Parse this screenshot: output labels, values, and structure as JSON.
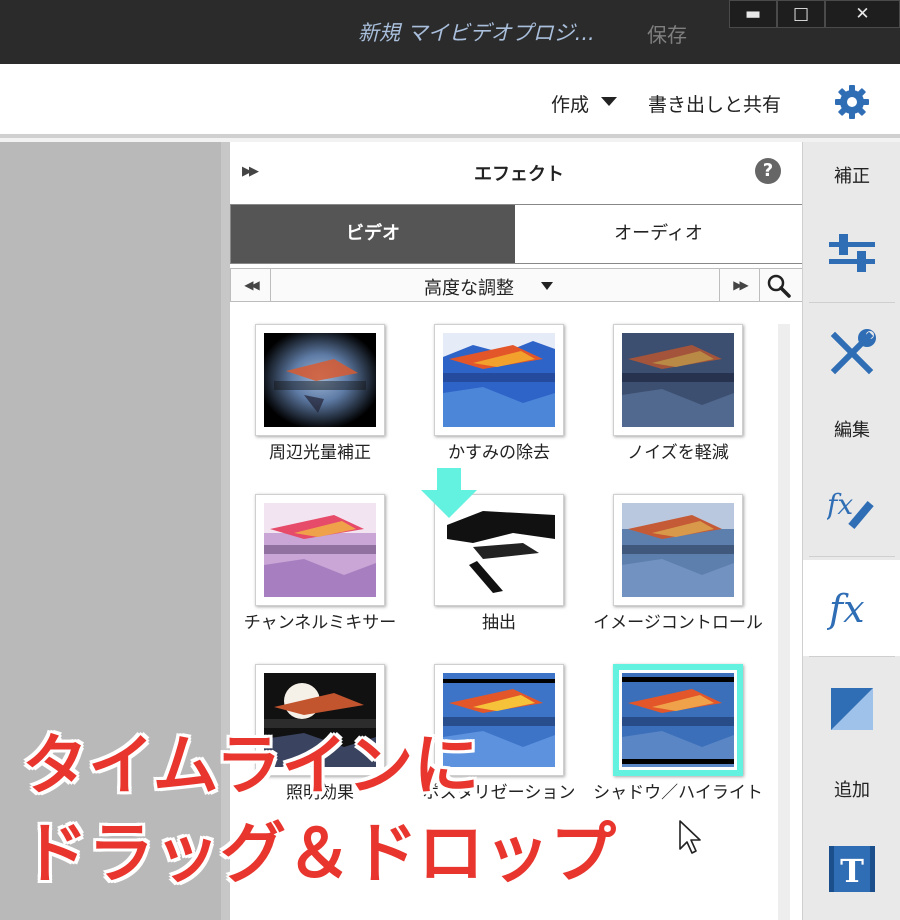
{
  "titlebar": {
    "project_title": "新規 マイビデオプロジ...",
    "save_label": "保存",
    "minimize_glyph": "▬",
    "maximize_glyph": "□",
    "close_glyph": "✕"
  },
  "menubar": {
    "create_label": "作成",
    "share_label": "書き出しと共有",
    "settings_icon": "gear-icon"
  },
  "effects_panel": {
    "expand_glyph": "▶▶",
    "title": "エフェクト",
    "help_glyph": "?",
    "tabs": [
      {
        "label": "ビデオ",
        "active": true
      },
      {
        "label": "オーディオ",
        "active": false
      }
    ],
    "category": {
      "prev_glyph": "◀◀",
      "label": "高度な調整",
      "next_glyph": "▶▶",
      "search_icon": "search-icon"
    },
    "effects": [
      {
        "label": "周辺光量補正",
        "thumbnail": "vignette"
      },
      {
        "label": "かすみの除去",
        "thumbnail": "haze-removal"
      },
      {
        "label": "ノイズを軽減",
        "thumbnail": "noise-reduction"
      },
      {
        "label": "チャンネルミキサー",
        "thumbnail": "channel-mixer"
      },
      {
        "label": "抽出",
        "thumbnail": "extract"
      },
      {
        "label": "イメージコントロール",
        "thumbnail": "image-control"
      },
      {
        "label": "照明効果",
        "thumbnail": "lighting"
      },
      {
        "label": "ポスタリゼーション",
        "thumbnail": "posterize"
      },
      {
        "label": "シャドウ／ハイライト",
        "thumbnail": "shadow-highlight",
        "highlighted": true
      }
    ]
  },
  "sidebar": {
    "section_adjust": "補正",
    "section_edit": "編集",
    "section_add": "追加",
    "buttons": [
      {
        "name": "adjust-sliders",
        "icon": "sliders-icon"
      },
      {
        "name": "tools",
        "icon": "wrench-screwdriver-icon"
      },
      {
        "name": "fx-edit",
        "icon": "fx-pencil-icon"
      },
      {
        "name": "fx",
        "icon": "fx-icon",
        "label": "fx",
        "active": true
      },
      {
        "name": "transitions",
        "icon": "transition-icon"
      },
      {
        "name": "titles",
        "icon": "title-t-icon",
        "label": "T"
      }
    ]
  },
  "overlay": {
    "line1": "タイムラインに",
    "line2": "ドラッグ＆ドロップ",
    "color": "#e8352e"
  },
  "colors": {
    "highlight": "#62f2df",
    "accent_blue": "#2f6db5",
    "titlebar": "#2b2b2b"
  }
}
